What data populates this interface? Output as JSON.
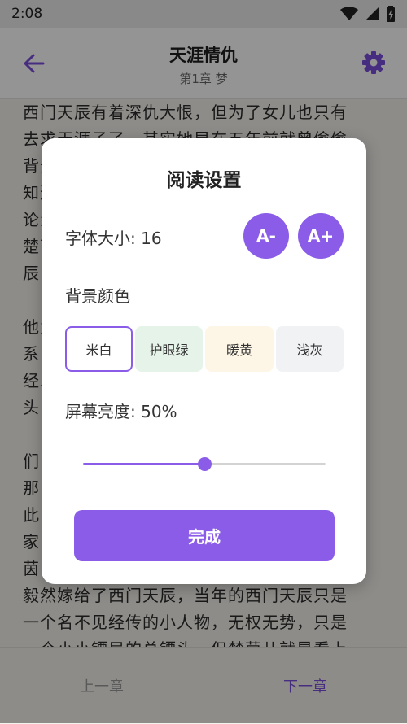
{
  "status_bar": {
    "time": "2:08"
  },
  "app_bar": {
    "book_title": "天涯情仇",
    "chapter_title": "第1章 梦"
  },
  "content": {
    "lines": [
      "西门天辰有着深仇大恨，但为了女儿也只有",
      "去求天涯子了，其实她早在五年前就曾偷偷",
      "背景颜色背景颜色背景颜色背景颜色背景子",
      "知道天涯子没有将她放在心上，但她也不",
      "论怎样，都要为女儿争一口气。",
      "楚茵儿的父亲是江湖上有名的高手，人称天",
      "辰，",
      "",
      "他为人豪爽，交友广阔，与江湖各派都有关，",
      "系，但因为一场误会，与天涯子结下了仇已",
      "经二十年了，当年天涯子曾经立誓，若是眉",
      "头",
      "",
      "们",
      "那",
      "此",
      "家",
      "茵",
      "毅然嫁给了西门天辰，当年的西门天辰只是",
      "一个名不见经传的小人物，无权无势，只是",
      "一个小小镖局的总镖头，但楚茵儿就是看上"
    ]
  },
  "bottom_bar": {
    "prev_label": "上一章",
    "next_label": "下一章"
  },
  "dialog": {
    "title": "阅读设置",
    "font_size_label": "字体大小: 16",
    "font_decrease_label": "A-",
    "font_increase_label": "A+",
    "background_label": "背景颜色",
    "swatches": [
      {
        "label": "米白",
        "color": "#ffffff",
        "selected": true
      },
      {
        "label": "护眼绿",
        "color": "#e6f3e9",
        "selected": false
      },
      {
        "label": "暖黄",
        "color": "#fdf6e6",
        "selected": false
      },
      {
        "label": "浅灰",
        "color": "#f1f2f4",
        "selected": false
      }
    ],
    "brightness_label": "屏幕亮度: 50%",
    "brightness_value": 0.5,
    "done_label": "完成"
  },
  "colors": {
    "accent": "#8a5ce8",
    "next_link": "#7b4fdb"
  },
  "icons": {
    "back": "arrow-left-icon",
    "settings": "gear-icon",
    "wifi": "wifi-icon",
    "signal": "signal-icon",
    "battery": "battery-charging-icon"
  }
}
